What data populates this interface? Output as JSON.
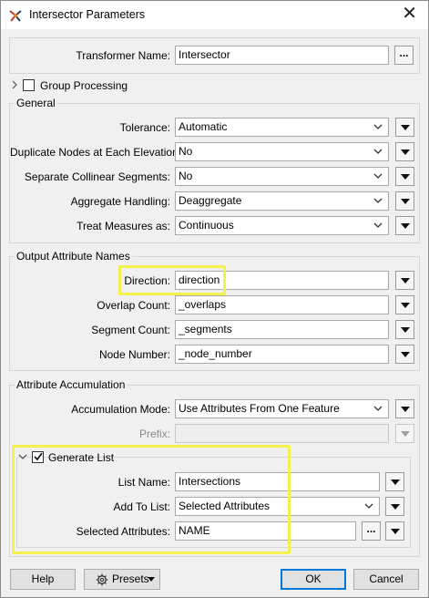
{
  "window": {
    "title": "Intersector Parameters",
    "close_glyph": "✕"
  },
  "transformer_name": {
    "label": "Transformer Name:",
    "value": "Intersector",
    "browse_label": "..."
  },
  "group_processing": {
    "label": "Group Processing",
    "checked": false
  },
  "general": {
    "title": "General",
    "rows": [
      {
        "label": "Tolerance:",
        "value": "Automatic"
      },
      {
        "label": "Duplicate Nodes at Each Elevation:",
        "value": "No"
      },
      {
        "label": "Separate Collinear Segments:",
        "value": "No"
      },
      {
        "label": "Aggregate Handling:",
        "value": "Deaggregate"
      },
      {
        "label": "Treat Measures as:",
        "value": "Continuous"
      }
    ]
  },
  "output_attribute_names": {
    "title": "Output Attribute Names",
    "rows": [
      {
        "label": "Direction:",
        "value": "direction"
      },
      {
        "label": "Overlap Count:",
        "value": "_overlaps"
      },
      {
        "label": "Segment Count:",
        "value": "_segments"
      },
      {
        "label": "Node Number:",
        "value": "_node_number"
      }
    ]
  },
  "attribute_accumulation": {
    "title": "Attribute Accumulation",
    "accumulation_mode": {
      "label": "Accumulation Mode:",
      "value": "Use Attributes From One Feature"
    },
    "prefix": {
      "label": "Prefix:",
      "value": ""
    },
    "generate_list": {
      "label": "Generate List",
      "checked": true,
      "list_name": {
        "label": "List Name:",
        "value": "Intersections"
      },
      "add_to_list": {
        "label": "Add To List:",
        "value": "Selected Attributes"
      },
      "selected_attributes": {
        "label": "Selected Attributes:",
        "value": "NAME",
        "browse_label": "..."
      }
    }
  },
  "footer": {
    "help_label": "Help",
    "presets_label": "Presets",
    "ok_label": "OK",
    "cancel_label": "Cancel"
  },
  "colors": {
    "highlight": "#f3f24c",
    "primary_border": "#0078d7"
  }
}
